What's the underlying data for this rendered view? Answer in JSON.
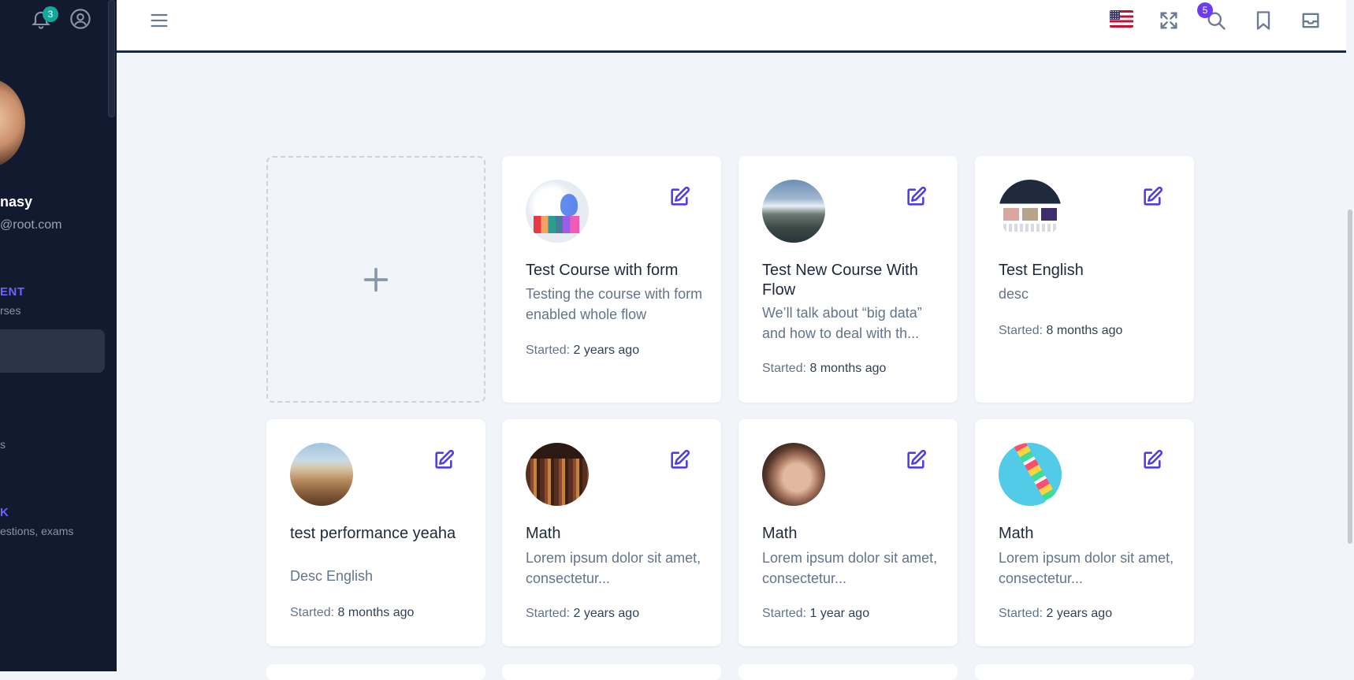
{
  "sidebar": {
    "notification_count": "3",
    "user_name": "nasy",
    "user_email": "@root.com",
    "section_management": "ENT",
    "section_management_sub": "rses",
    "fragment_s": "s",
    "section_bank": "K",
    "section_bank_sub": "estions, exams"
  },
  "topbar": {
    "mail_count": "5",
    "language": "English (US)"
  },
  "colors": {
    "accent": "#4f3ee6",
    "sidebar_bg": "#111a2e",
    "page_bg": "#f1f4f9",
    "badge_teal": "#12a89a",
    "badge_purple": "#6c3cf5"
  },
  "courses": [
    {
      "title": "Test Course with form",
      "desc": "Testing the course with form enabled whole flow",
      "started_label": "Started:",
      "started_value": "2 years ago",
      "thumb": "lab-glassware"
    },
    {
      "title": "Test New Course With Flow",
      "desc": "We’ll talk about “big data” and how to deal with th...",
      "started_label": "Started:",
      "started_value": "8 months ago",
      "thumb": "mountain-lake"
    },
    {
      "title": "Test English",
      "desc": "desc",
      "started_label": "Started:",
      "started_value": "8 months ago",
      "thumb": "website-screens"
    },
    {
      "title": "test performance yeaha",
      "desc": "Desc English",
      "started_label": "Started:",
      "started_value": "8 months ago",
      "thumb": "desert-dunes"
    },
    {
      "title": "Math",
      "desc": "Lorem ipsum dolor sit amet, consectetur...",
      "started_label": "Started:",
      "started_value": "2 years ago",
      "thumb": "bookshelf"
    },
    {
      "title": "Math",
      "desc": "Lorem ipsum dolor sit amet, consectetur...",
      "started_label": "Started:",
      "started_value": "1 year ago",
      "thumb": "portrait"
    },
    {
      "title": "Math",
      "desc": "Lorem ipsum dolor sit amet, consectetur...",
      "started_label": "Started:",
      "started_value": "2 years ago",
      "thumb": "colored-pencils"
    }
  ]
}
